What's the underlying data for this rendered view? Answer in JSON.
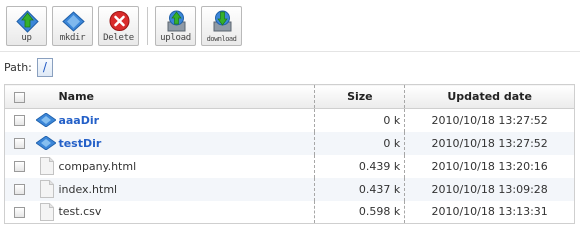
{
  "toolbar": {
    "up_label": "up",
    "mkdir_label": "mkdir",
    "delete_label": "Delete",
    "upload_label": "upload",
    "download_label": "download"
  },
  "path": {
    "label": "Path:",
    "current": "/"
  },
  "table": {
    "columns": {
      "name": "Name",
      "size": "Size",
      "updated": "Updated date"
    },
    "rows": [
      {
        "type": "dir",
        "name": "aaaDir",
        "size": "0 k",
        "updated": "2010/10/18 13:27:52"
      },
      {
        "type": "dir",
        "name": "testDir",
        "size": "0 k",
        "updated": "2010/10/18 13:27:52"
      },
      {
        "type": "file",
        "name": "company.html",
        "size": "0.439 k",
        "updated": "2010/10/18 13:20:16"
      },
      {
        "type": "file",
        "name": "index.html",
        "size": "0.437 k",
        "updated": "2010/10/18 13:09:28"
      },
      {
        "type": "file",
        "name": "test.csv",
        "size": "0.598 k",
        "updated": "2010/10/18 13:13:31"
      }
    ]
  },
  "colors": {
    "link": "#2460c8",
    "alt_row": "#f3f6fa",
    "folder": "#3b86d8",
    "up_arrow": "#35b02b",
    "delete": "#d92b2b"
  },
  "icons": {
    "up": "up-arrow-icon",
    "mkdir": "folder-diamond-icon",
    "delete": "delete-x-icon",
    "upload": "upload-icon",
    "download": "download-icon",
    "dir": "folder-icon",
    "file": "file-icon"
  }
}
